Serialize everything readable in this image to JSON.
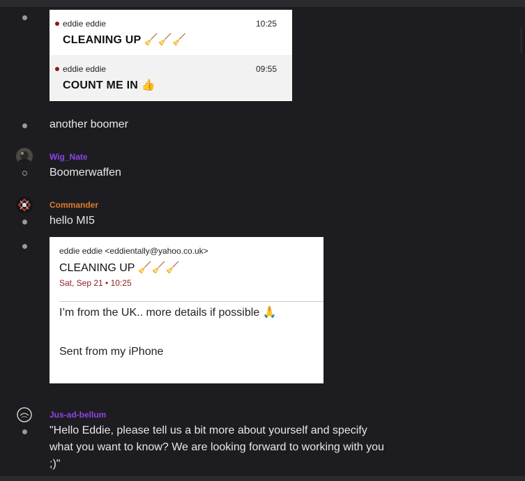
{
  "notification_card": {
    "items": [
      {
        "sender": "eddie eddie",
        "time": "10:25",
        "subject": "CLEANING UP 🧹🧹🧹"
      },
      {
        "sender": "eddie eddie",
        "time": "09:55",
        "subject": "COUNT ME IN 👍"
      }
    ]
  },
  "messages": [
    {
      "text": "another boomer"
    },
    {
      "author": "Wig_Nate",
      "author_color": "#8e44e8",
      "text": "Boomerwaffen"
    },
    {
      "author": "Commander",
      "author_color": "#e07b2a",
      "text": "hello MI5"
    }
  ],
  "email_card": {
    "from": "eddie eddie <eddientally@yahoo.co.uk>",
    "subject": "CLEANING UP 🧹🧹🧹",
    "date": "Sat, Sep 21 • 10:25",
    "body_line1": "I’m from the UK.. more details if possible 🙏",
    "body_line2": "Sent from my iPhone"
  },
  "last_message": {
    "author": "Jus-ad-bellum",
    "author_color": "#8e44e8",
    "line1": "\"Hello Eddie, please tell us a bit more about yourself and specify",
    "line2": "what you want to know? We are looking forward to working with you",
    "line3": ";)\""
  }
}
